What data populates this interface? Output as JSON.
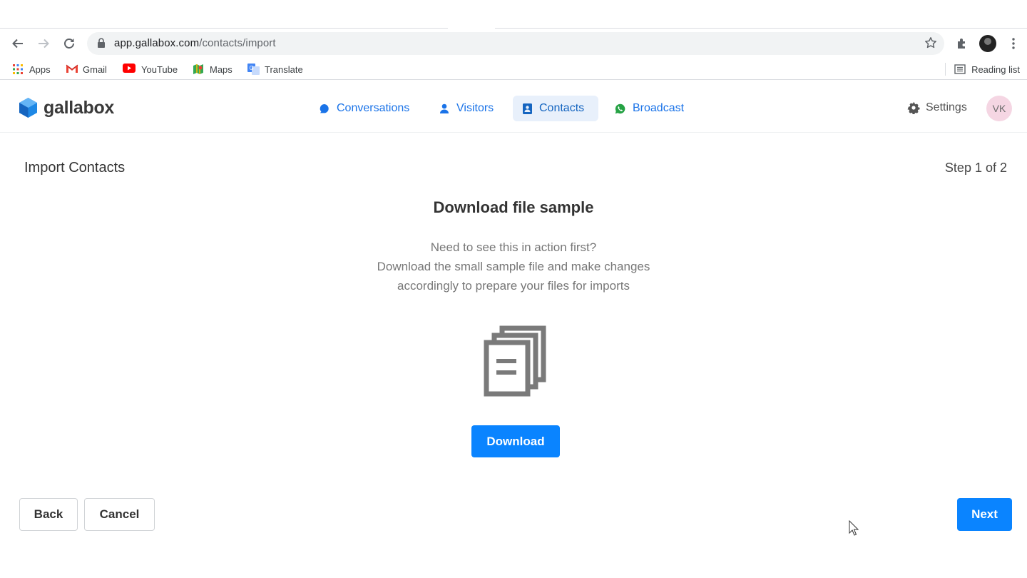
{
  "browser": {
    "url_host": "app.gallabox.com",
    "url_path": "/contacts/import",
    "bookmarks": [
      {
        "label": "Apps",
        "icon": "apps-grid-icon"
      },
      {
        "label": "Gmail",
        "icon": "gmail-icon"
      },
      {
        "label": "YouTube",
        "icon": "youtube-icon"
      },
      {
        "label": "Maps",
        "icon": "maps-icon"
      },
      {
        "label": "Translate",
        "icon": "translate-icon"
      }
    ],
    "reading_list": "Reading list"
  },
  "app": {
    "logo_text": "gallabox",
    "nav": [
      {
        "label": "Conversations",
        "icon": "chat-bubble-icon"
      },
      {
        "label": "Visitors",
        "icon": "person-icon"
      },
      {
        "label": "Contacts",
        "icon": "contact-card-icon",
        "active": true
      },
      {
        "label": "Broadcast",
        "icon": "whatsapp-icon"
      }
    ],
    "settings_label": "Settings",
    "avatar_initials": "VK"
  },
  "page": {
    "title": "Import Contacts",
    "step": "Step 1 of 2",
    "section_title": "Download file sample",
    "description": [
      "Need to see this in action first?",
      "Download the small sample file and make changes",
      "accordingly to prepare your files for imports"
    ],
    "download_label": "Download",
    "back_label": "Back",
    "cancel_label": "Cancel",
    "next_label": "Next"
  },
  "colors": {
    "primary": "#0a84ff",
    "nav_text": "#1a73e8",
    "nav_active_bg": "#e8f0fb",
    "avatar_bg": "#f5d6e3"
  }
}
